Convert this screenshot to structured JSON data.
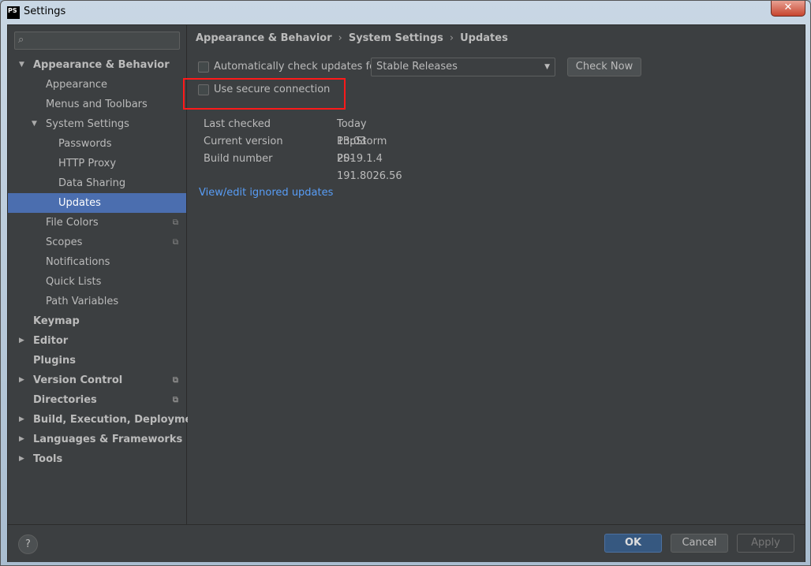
{
  "window": {
    "title": "Settings",
    "logo": "PS",
    "close": "✕"
  },
  "sidebar": {
    "search_placeholder": "",
    "items": [
      {
        "label": "Appearance & Behavior",
        "level": 0,
        "bold": true,
        "arrow": "▼"
      },
      {
        "label": "Appearance",
        "level": 1
      },
      {
        "label": "Menus and Toolbars",
        "level": 1
      },
      {
        "label": "System Settings",
        "level": 1,
        "arrow": "▼"
      },
      {
        "label": "Passwords",
        "level": 2
      },
      {
        "label": "HTTP Proxy",
        "level": 2
      },
      {
        "label": "Data Sharing",
        "level": 2
      },
      {
        "label": "Updates",
        "level": 2,
        "selected": true
      },
      {
        "label": "File Colors",
        "level": 1,
        "copy": true
      },
      {
        "label": "Scopes",
        "level": 1,
        "copy": true
      },
      {
        "label": "Notifications",
        "level": 1
      },
      {
        "label": "Quick Lists",
        "level": 1
      },
      {
        "label": "Path Variables",
        "level": 1
      },
      {
        "label": "Keymap",
        "level": 0,
        "bold": true
      },
      {
        "label": "Editor",
        "level": 0,
        "bold": true,
        "arrow": "▶"
      },
      {
        "label": "Plugins",
        "level": 0,
        "bold": true
      },
      {
        "label": "Version Control",
        "level": 0,
        "bold": true,
        "arrow": "▶",
        "copy": true
      },
      {
        "label": "Directories",
        "level": 0,
        "bold": true,
        "copy": true
      },
      {
        "label": "Build, Execution, Deployment",
        "level": 0,
        "bold": true,
        "arrow": "▶"
      },
      {
        "label": "Languages & Frameworks",
        "level": 0,
        "bold": true,
        "arrow": "▶"
      },
      {
        "label": "Tools",
        "level": 0,
        "bold": true,
        "arrow": "▶"
      }
    ]
  },
  "main": {
    "breadcrumb": [
      "Appearance & Behavior",
      "System Settings",
      "Updates"
    ],
    "auto_check_label": "Automatically check updates for",
    "auto_check_checked": false,
    "channel": "Stable Releases",
    "check_now": "Check Now",
    "secure_label": "Use secure connection",
    "secure_checked": false,
    "highlight_color": "#ff1a1a",
    "info": {
      "last_checked_label": "Last checked",
      "last_checked": "Today 13:03",
      "current_version_label": "Current version",
      "current_version": "PhpStorm 2019.1.4",
      "build_number_label": "Build number",
      "build_number": "PS-191.8026.56"
    },
    "ignored_link": "View/edit ignored updates"
  },
  "footer": {
    "help": "?",
    "ok": "OK",
    "cancel": "Cancel",
    "apply": "Apply"
  }
}
